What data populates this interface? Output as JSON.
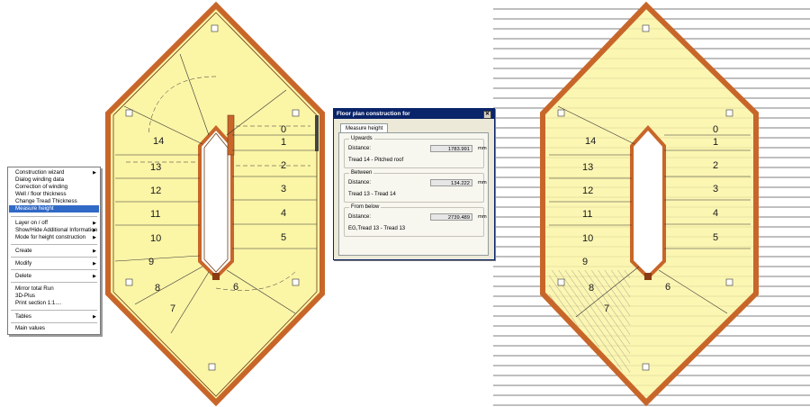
{
  "left_plan": {
    "tread_numbers": [
      "0",
      "1",
      "2",
      "3",
      "4",
      "5",
      "6",
      "7",
      "8",
      "9",
      "10",
      "11",
      "12",
      "13",
      "14"
    ]
  },
  "right_plan": {
    "tread_numbers": [
      "0",
      "1",
      "2",
      "3",
      "4",
      "5",
      "6",
      "7",
      "8",
      "9",
      "10",
      "11",
      "12",
      "13",
      "14"
    ]
  },
  "context_menu": {
    "items": [
      {
        "label": "Construction wizard",
        "submenu": true
      },
      {
        "label": "Dialog winding data",
        "submenu": false
      },
      {
        "label": "Correction of winding",
        "submenu": false
      },
      {
        "label": "Well / floor thickness",
        "submenu": false
      },
      {
        "label": "Change Tread Thickness",
        "submenu": false
      },
      {
        "label": "Measure height",
        "submenu": false,
        "selected": true
      },
      {
        "label": "Layer on / off",
        "submenu": true
      },
      {
        "label": "Show/Hide Additional Information",
        "submenu": true
      },
      {
        "label": "Mode for height construction",
        "submenu": true
      },
      {
        "label": "Create",
        "submenu": true
      },
      {
        "label": "Modify",
        "submenu": true
      },
      {
        "label": "Delete",
        "submenu": true
      },
      {
        "label": "Mirror total Run",
        "submenu": false
      },
      {
        "label": "3D-Plus",
        "submenu": false
      },
      {
        "label": "Print section 1:1....",
        "submenu": false
      },
      {
        "label": "Tables",
        "submenu": true
      },
      {
        "label": "Main values",
        "submenu": false
      }
    ],
    "arrow_glyph": "▶"
  },
  "dialog": {
    "title": "Floor plan construction for",
    "close_glyph": "✕",
    "tab": "Measure height",
    "upwards": {
      "title": "Upwards",
      "label": "Distance:",
      "value": "1783.991",
      "unit": "mm",
      "info": "Tread 14 - Pitched roof"
    },
    "between": {
      "title": "Between",
      "label": "Distance:",
      "value": "134.222",
      "unit": "mm",
      "info": "Tread 13 - Tread 14"
    },
    "from_below": {
      "title": "From below",
      "label": "Distance:",
      "value": "2739.489",
      "unit": "mm",
      "info": "EG,Tread 13 - Tread 13"
    }
  },
  "colors": {
    "accent": "#3169c6",
    "fill": "#fbf5a6",
    "wood": "#c8662a",
    "title_bar": "#0a246a"
  }
}
